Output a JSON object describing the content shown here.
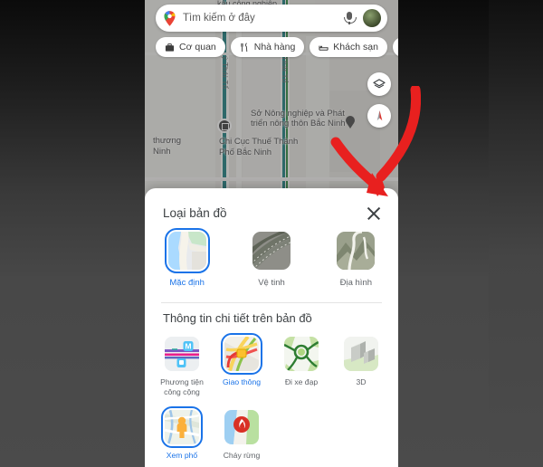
{
  "app": {
    "name": "Google Maps",
    "language": "vi"
  },
  "search": {
    "placeholder": "Tìm kiếm ở đây",
    "pin_icon": "google-maps-pin-icon",
    "mic_icon": "microphone-icon",
    "avatar_icon": "account-avatar"
  },
  "chips": [
    {
      "label": "Cơ quan",
      "icon": "briefcase-icon"
    },
    {
      "label": "Nhà hàng",
      "icon": "restaurant-icon"
    },
    {
      "label": "Khách sạn",
      "icon": "hotel-bed-icon"
    },
    {
      "label": "",
      "icon": "shopping-bag-icon"
    }
  ],
  "map_controls": [
    {
      "name": "layers-button",
      "icon": "layers-icon"
    },
    {
      "name": "compass-button",
      "icon": "compass-icon"
    }
  ],
  "map_labels": {
    "top_partial": "kâu công nghiệp",
    "street_left": "ý Thái Tổ",
    "street_right": "Thái Tổ",
    "poi_1_line1": "Sở Nông nghiệp và Phát",
    "poi_1_line2": "triển nông thôn Bắc Ninh",
    "poi_2_line1": "Chi Cục Thuế Thành",
    "poi_2_line2": "Phố Bắc Ninh",
    "edge_line1": "thương",
    "edge_line2": "Ninh"
  },
  "sheet": {
    "title": "Loại bản đồ",
    "close_label": "×",
    "close_icon": "close-icon",
    "map_types": [
      {
        "label": "Mặc định",
        "icon": "default-map-thumbnail",
        "selected": true
      },
      {
        "label": "Vệ tinh",
        "icon": "satellite-map-thumbnail",
        "selected": false
      },
      {
        "label": "Địa hình",
        "icon": "terrain-map-thumbnail",
        "selected": false
      }
    ],
    "details_title": "Thông tin chi tiết trên bản đồ",
    "details": [
      {
        "label": "Phương tiện công cộng",
        "icon": "transit-icon",
        "selected": false
      },
      {
        "label": "Giao thông",
        "icon": "traffic-icon",
        "selected": true
      },
      {
        "label": "Đi xe đạp",
        "icon": "bicycling-icon",
        "selected": false
      },
      {
        "label": "3D",
        "icon": "3d-buildings-icon",
        "selected": false
      },
      {
        "label": "Xem phố",
        "icon": "street-view-icon",
        "selected": true
      },
      {
        "label": "Cháy rừng",
        "icon": "wildfires-icon",
        "selected": false
      }
    ]
  },
  "annotation": {
    "arrow": "red-curved-arrow-pointing-to-close-button",
    "color": "#e8201f"
  },
  "colors": {
    "accent": "#1a73e8",
    "sheet_bg": "#ffffff",
    "text_primary": "#3c4043",
    "text_secondary": "#5f6368",
    "backdrop": "#3f3f3f",
    "annotation_red": "#e8201f"
  }
}
